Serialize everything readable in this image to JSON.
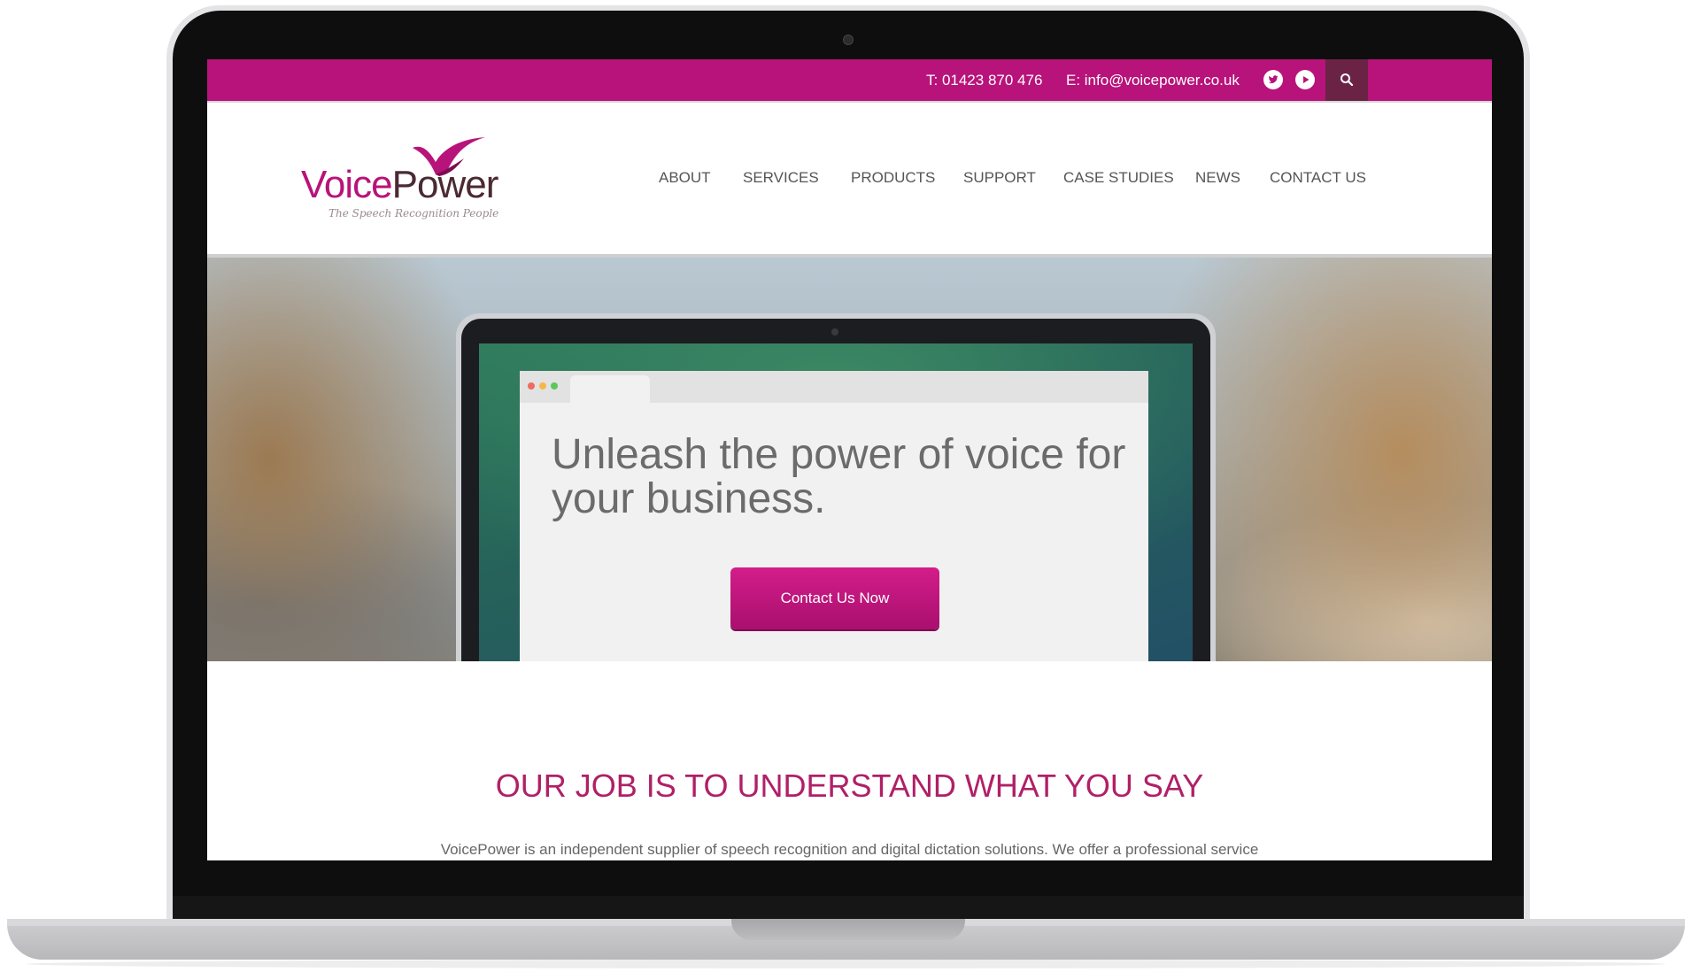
{
  "topbar": {
    "phone": "T: 01423 870 476",
    "email": "E: info@voicepower.co.uk",
    "icons": [
      "twitter-icon",
      "youtube-play-icon",
      "search-icon"
    ]
  },
  "brand": {
    "name_part1": "Voice",
    "name_part2": "Power",
    "tagline": "The Speech Recognition People",
    "accent_color": "#b8137a"
  },
  "nav": {
    "items": [
      "ABOUT",
      "SERVICES",
      "PRODUCTS",
      "SUPPORT",
      "CASE STUDIES",
      "NEWS",
      "CONTACT US"
    ]
  },
  "hero": {
    "headline": "Unleash the power of voice for your business.",
    "cta_label": "Contact Us Now"
  },
  "intro": {
    "title": "OUR JOB IS TO UNDERSTAND WHAT YOU SAY",
    "text": "VoicePower is an independent supplier of speech recognition and digital dictation solutions. We offer a professional service"
  }
}
